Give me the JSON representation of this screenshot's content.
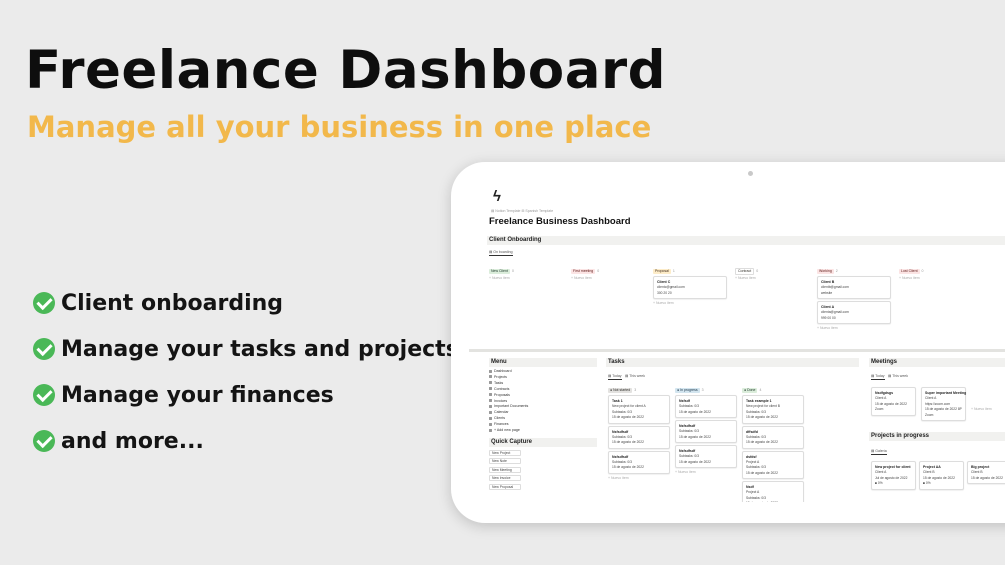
{
  "hero": {
    "title": "Freelance Dashboard",
    "subtitle": "Manage all your business in one place"
  },
  "features": [
    "Client onboarding",
    "Manage your tasks and projects",
    "Manage your finances",
    "and more..."
  ],
  "colors": {
    "accent": "#f2b84b",
    "check": "#4ab857",
    "background": "#ebebeb"
  },
  "app": {
    "logo_icon": "lightning-bolt-icon",
    "breadcrumb": "▤ Notion Template   ⊞ Spanish Template",
    "title": "Freelance Business Dashboard",
    "onboarding": {
      "heading": "Client Onboarding",
      "view": "▤ On boarding",
      "add_item": "+ Nuevo item",
      "columns": [
        {
          "tag": "New Client",
          "color": "#dbeddb",
          "text": "#1c3829",
          "count": "0",
          "cards": []
        },
        {
          "tag": "First meeting",
          "color": "#fbe4e4",
          "text": "#5d1715",
          "count": "0",
          "cards": []
        },
        {
          "tag": "Proposal",
          "color": "#fdecc8",
          "text": "#402c1b",
          "count": "1",
          "cards": [
            {
              "title": "Client C",
              "lines": [
                "clientc@gmail.com",
                "300 20 20"
              ]
            }
          ]
        },
        {
          "tag": "Contract",
          "color": "#ffffff",
          "text": "#37352f",
          "count": "0",
          "cards": []
        },
        {
          "tag": "Working",
          "color": "#fbe4e4",
          "text": "#5d1715",
          "count": "2",
          "cards": [
            {
              "title": "Client B",
              "lines": [
                "clientb@gmail.com",
                "website"
              ]
            },
            {
              "title": "Client A",
              "lines": [
                "clienta@gmail.com",
                "999 00 00"
              ]
            }
          ]
        },
        {
          "tag": "Lost Client",
          "color": "#fbe4e4",
          "text": "#5d1715",
          "count": "0",
          "cards": []
        }
      ]
    },
    "menu": {
      "heading": "Menu",
      "items": [
        "Dashboard",
        "Projects",
        "Tasks",
        "Contracts",
        "Proposals",
        "Invoices",
        "Important Documents",
        "Calendar",
        "Clients",
        "Finances",
        "+ Add new page"
      ]
    },
    "quick_capture": {
      "heading": "Quick Capture",
      "items": [
        "New Project",
        "New Note",
        "New Meeting",
        "New Invoice",
        "New Proposal"
      ]
    },
    "tasks": {
      "heading": "Tasks",
      "tabs": [
        "▤ Today",
        "▤ This week"
      ],
      "add_item": "+ Nuevo item",
      "columns": [
        {
          "tag": "● Not started",
          "color": "#e3e2e0",
          "text": "#32302c",
          "count": "3",
          "cards": [
            {
              "title": "Task 1",
              "lines": [
                "New project for client A",
                "Subtasks: 0/3",
                "15 de agosto de 2022"
              ]
            },
            {
              "title": "Nsfsdfsdf",
              "lines": [
                "Subtasks: 0/3",
                "15 de agosto de 2022"
              ]
            },
            {
              "title": "Nsfsdfsdf",
              "lines": [
                "Subtasks: 0/3",
                "15 de agosto de 2022"
              ]
            }
          ]
        },
        {
          "tag": "● In progress",
          "color": "#d3e5ef",
          "text": "#183347",
          "count": "3",
          "cards": [
            {
              "title": "Nsfsdf",
              "lines": [
                "Subtasks: 0/3",
                "15 de agosto de 2022"
              ]
            },
            {
              "title": "Nsfsdfsdf",
              "lines": [
                "Subtasks: 0/3",
                "15 de agosto de 2022"
              ]
            },
            {
              "title": "Nsfsdfsdf",
              "lines": [
                "Subtasks: 0/3",
                "15 de agosto de 2022"
              ]
            }
          ]
        },
        {
          "tag": "● Done",
          "color": "#dbeddb",
          "text": "#1c3829",
          "count": "4",
          "cards": [
            {
              "title": "Task example 1",
              "lines": [
                "New project for client B",
                "Subtasks: 0/3",
                "15 de agosto de 2022"
              ]
            },
            {
              "title": "dffsdfd",
              "lines": [
                "Subtasks: 0/3",
                "15 de agosto de 2022"
              ]
            },
            {
              "title": "dsfdsf",
              "lines": [
                "Project A",
                "Subtasks: 0/3",
                "15 de agosto de 2022"
              ]
            },
            {
              "title": "Nsdf",
              "lines": [
                "Project A",
                "Subtasks: 0/3",
                "15 de agosto de 2022"
              ]
            }
          ]
        }
      ]
    },
    "meetings": {
      "heading": "Meetings",
      "tabs": [
        "▤ Today",
        "▤ This week"
      ],
      "add_item": "+ Nuevo item",
      "cards": [
        {
          "title": "Nsdfgdsgs",
          "lines": [
            "Client A",
            "15 de agosto de 2022",
            "Zoom"
          ]
        },
        {
          "title": "Super important Meeting",
          "lines": [
            "Client A",
            "https://zoom.com",
            "15 de agosto de 2022 8PM",
            "Zoom"
          ]
        }
      ]
    },
    "projects": {
      "heading": "Projects in progress",
      "tab": "▤ Galería",
      "add_item": "+ Nuevo item",
      "cards": [
        {
          "title": "New project for client",
          "lines": [
            "Client A",
            "Jul de agosto de 2022",
            "■ 0%"
          ]
        },
        {
          "title": "Project AA",
          "lines": [
            "Client B",
            "15 de agosto de 2022",
            "■ 0%"
          ]
        },
        {
          "title": "Big project",
          "lines": [
            "Client B",
            "15 de agosto de 2022"
          ]
        }
      ]
    }
  }
}
